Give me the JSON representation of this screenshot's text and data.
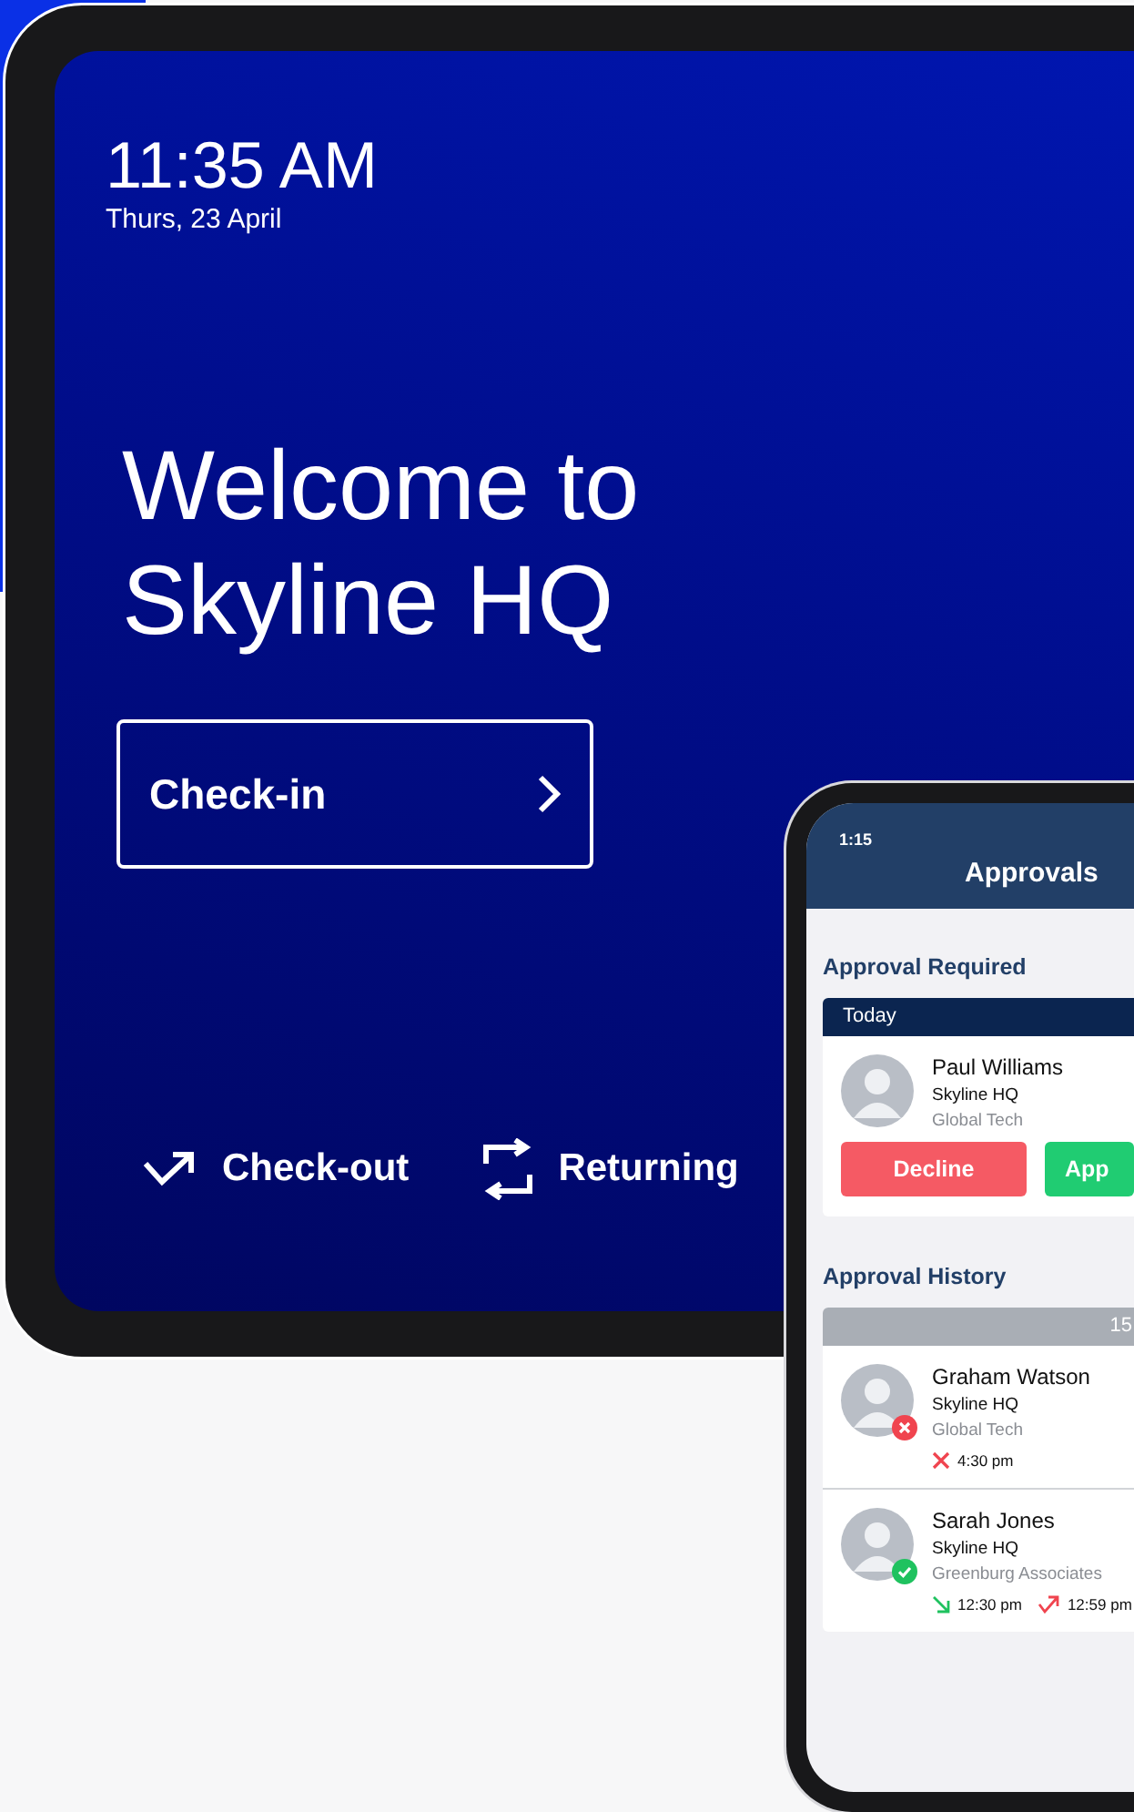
{
  "tablet": {
    "time": "11:35 AM",
    "date": "Thurs, 23 April",
    "welcome": [
      "Welcome to",
      "Skyline HQ"
    ],
    "primary_action": {
      "label": "Check-in"
    },
    "secondary_actions": [
      {
        "kind": "check-out",
        "label": "Check-out"
      },
      {
        "kind": "returning",
        "label": "Returning"
      }
    ]
  },
  "phone": {
    "status_time": "1:15",
    "title": "Approvals",
    "required": {
      "heading": "Approval Required",
      "group": "Today",
      "people": [
        {
          "name": "Paul Williams",
          "site": "Skyline HQ",
          "company": "Global Tech",
          "buttons": [
            {
              "kind": "decline",
              "label": "Decline"
            },
            {
              "kind": "approve",
              "label": "App"
            }
          ]
        }
      ]
    },
    "history": {
      "heading": "Approval History",
      "group": "15",
      "people": [
        {
          "name": "Graham Watson",
          "site": "Skyline HQ",
          "company": "Global Tech",
          "approved": false,
          "events": [
            {
              "kind": "declined",
              "time": "4:30 pm"
            }
          ]
        },
        {
          "name": "Sarah Jones",
          "site": "Skyline HQ",
          "company": "Greenburg Associates",
          "approved": true,
          "events": [
            {
              "kind": "in",
              "time": "12:30 pm"
            },
            {
              "kind": "out",
              "time": "12:59 pm"
            }
          ]
        }
      ]
    }
  }
}
